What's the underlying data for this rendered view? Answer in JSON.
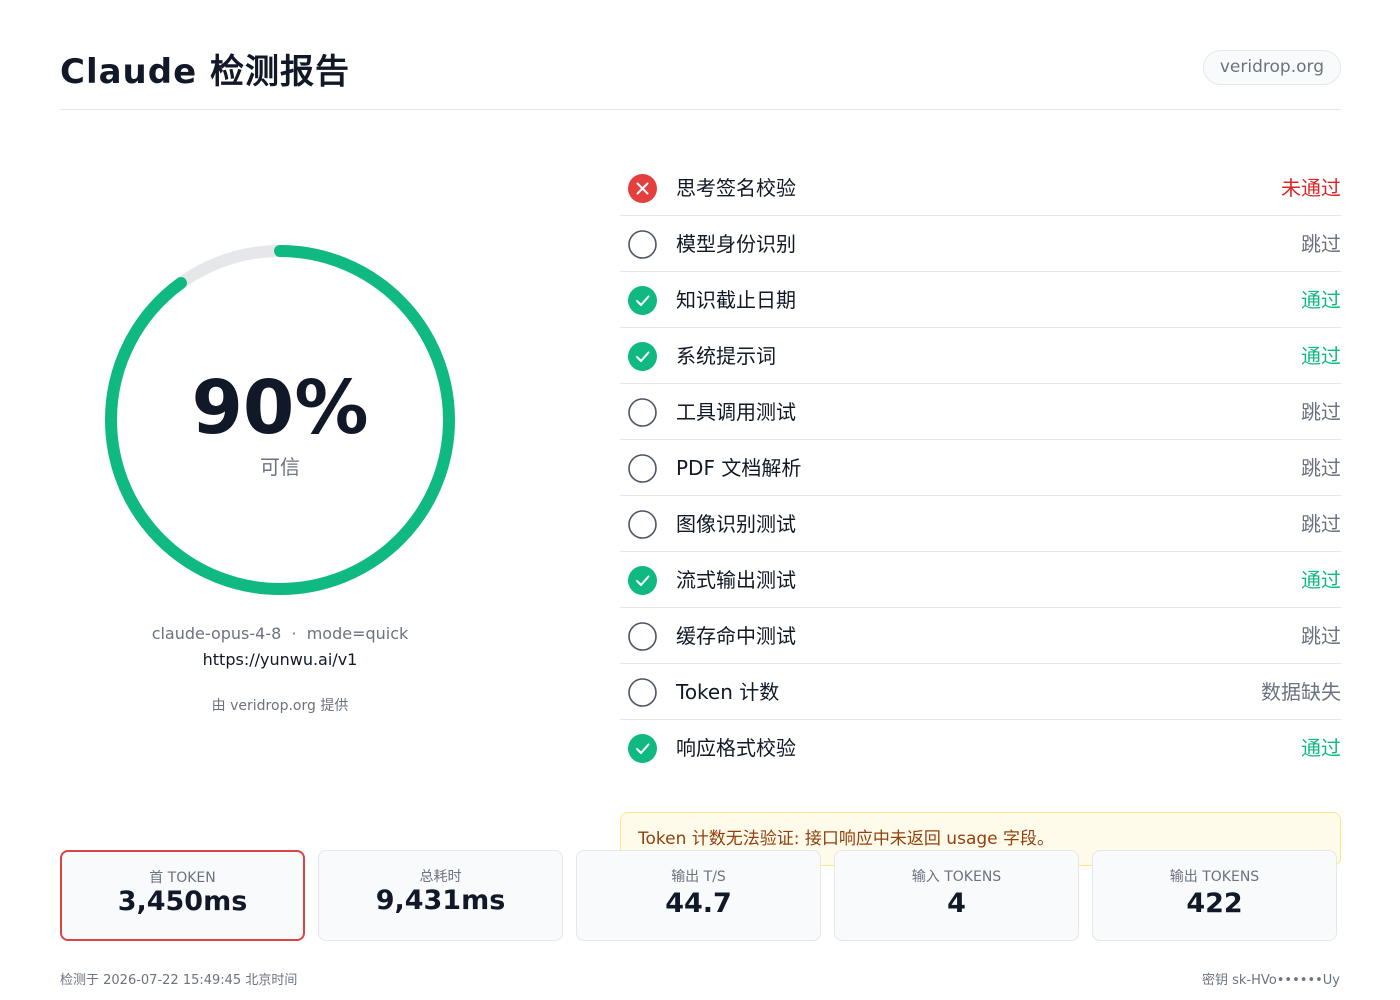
{
  "header": {
    "title": "Claude 检测报告",
    "site": "veridrop.org"
  },
  "score": {
    "percent": 0.9,
    "percent_text": "90%",
    "label": "可信",
    "model": "claude-opus-4-8",
    "separator": "·",
    "mode": "mode=quick",
    "url": "https://yunwu.ai/v1",
    "source": "由 veridrop.org 提供",
    "ring_color": "#10b981"
  },
  "checks": [
    {
      "label": "思考签名校验",
      "status": "未通过",
      "state": "fail"
    },
    {
      "label": "模型身份识别",
      "status": "跳过",
      "state": "skip"
    },
    {
      "label": "知识截止日期",
      "status": "通过",
      "state": "pass"
    },
    {
      "label": "系统提示词",
      "status": "通过",
      "state": "pass"
    },
    {
      "label": "工具调用测试",
      "status": "跳过",
      "state": "skip"
    },
    {
      "label": "PDF 文档解析",
      "status": "跳过",
      "state": "skip"
    },
    {
      "label": "图像识别测试",
      "status": "跳过",
      "state": "skip"
    },
    {
      "label": "流式输出测试",
      "status": "通过",
      "state": "pass"
    },
    {
      "label": "缓存命中测试",
      "status": "跳过",
      "state": "skip"
    },
    {
      "label": "Token 计数",
      "status": "数据缺失",
      "state": "skip"
    },
    {
      "label": "响应格式校验",
      "status": "通过",
      "state": "pass"
    }
  ],
  "warning": "Token 计数无法验证: 接口响应中未返回 usage 字段。",
  "metrics": [
    {
      "label": "首 TOKEN",
      "value": "3,450ms",
      "highlight": true
    },
    {
      "label": "总耗时",
      "value": "9,431ms",
      "highlight": false
    },
    {
      "label": "输出 T/S",
      "value": "44.7",
      "highlight": false
    },
    {
      "label": "输入 TOKENS",
      "value": "4",
      "highlight": false
    },
    {
      "label": "输出 TOKENS",
      "value": "422",
      "highlight": false
    }
  ],
  "footer": {
    "left": "检测于 2026-07-22 15:49:45 北京时间",
    "right": "密钥 sk-HVo••••••Uy"
  },
  "colors": {
    "pass": "#10b981",
    "fail": "#dc2626",
    "skip": "#6b7280",
    "metric_highlight_border": "#d94545"
  }
}
